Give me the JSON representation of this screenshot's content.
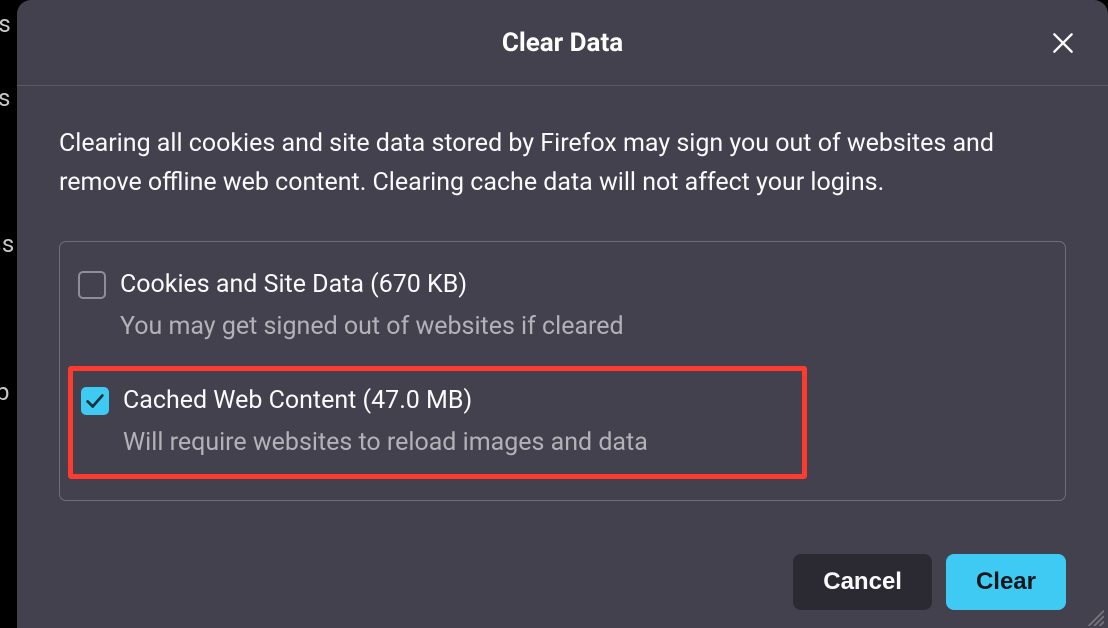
{
  "background_fragments": [
    "is",
    "s",
    "ss",
    "p"
  ],
  "dialog": {
    "title": "Clear Data",
    "description": "Clearing all cookies and site data stored by Firefox may sign you out of websites and remove offline web content. Clearing cache data will not affect your logins.",
    "options": [
      {
        "checked": false,
        "label": "Cookies and Site Data (670 KB)",
        "desc": "You may get signed out of websites if cleared"
      },
      {
        "checked": true,
        "label": "Cached Web Content (47.0 MB)",
        "desc": "Will require websites to reload images and data"
      }
    ],
    "buttons": {
      "cancel": "Cancel",
      "clear": "Clear"
    }
  }
}
